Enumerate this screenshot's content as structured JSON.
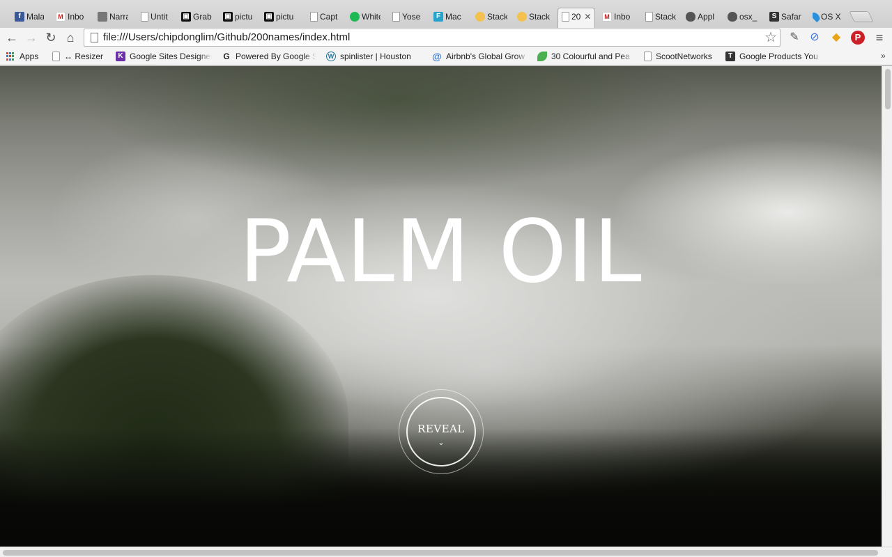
{
  "browser": {
    "tabs": [
      {
        "label": "Mala",
        "icon": "facebook-icon"
      },
      {
        "label": "Inbo",
        "icon": "gmail-icon"
      },
      {
        "label": "Narra",
        "icon": "contacts-icon"
      },
      {
        "label": "Untit",
        "icon": "page-icon"
      },
      {
        "label": "Grab",
        "icon": "grab-icon"
      },
      {
        "label": "pictu",
        "icon": "grab-icon"
      },
      {
        "label": "pictu",
        "icon": "grab-icon"
      },
      {
        "label": "Capt",
        "icon": "page-icon"
      },
      {
        "label": "White",
        "icon": "spotify-icon"
      },
      {
        "label": "Yose",
        "icon": "page-icon"
      },
      {
        "label": "Mac",
        "icon": "f-icon"
      },
      {
        "label": "Stack",
        "icon": "stackoverflow-icon"
      },
      {
        "label": "Stack",
        "icon": "stackoverflow-icon"
      },
      {
        "label": "20",
        "icon": "page-icon",
        "active": true
      },
      {
        "label": "Inbo",
        "icon": "gmail-icon"
      },
      {
        "label": "Stack",
        "icon": "page-icon"
      },
      {
        "label": "Appl",
        "icon": "apple-icon"
      },
      {
        "label": "osx_",
        "icon": "apple-icon"
      },
      {
        "label": "Safar",
        "icon": "safari-icon"
      },
      {
        "label": "OS X",
        "icon": "drop-icon"
      }
    ],
    "address_bar": {
      "url": "file:///Users/chipdonglim/Github/200names/index.html"
    },
    "bookmarks": [
      {
        "label": "Apps",
        "icon": "apps-grid-icon"
      },
      {
        "label": "↔ Resizer",
        "icon": "page-icon"
      },
      {
        "label": "Google Sites Designer",
        "icon": "k-icon"
      },
      {
        "label": "Powered By Google S",
        "icon": "g-icon"
      },
      {
        "label": "spinlister | Houston",
        "icon": "wordpress-icon"
      },
      {
        "label": "Airbnb's Global Grow",
        "icon": "at-icon"
      },
      {
        "label": "30 Colourful and Pea",
        "icon": "leaf-icon"
      },
      {
        "label": "ScootNetworks",
        "icon": "page-icon"
      },
      {
        "label": "Google Products You",
        "icon": "t-icon"
      }
    ],
    "bookmarks_overflow": "»"
  },
  "hero": {
    "title": "PALM OIL",
    "reveal_label": "REVEAL",
    "reveal_chevron": "⌄"
  },
  "colors": {
    "hero_text": "#ffffff",
    "browser_chrome": "#f4f4f4"
  }
}
